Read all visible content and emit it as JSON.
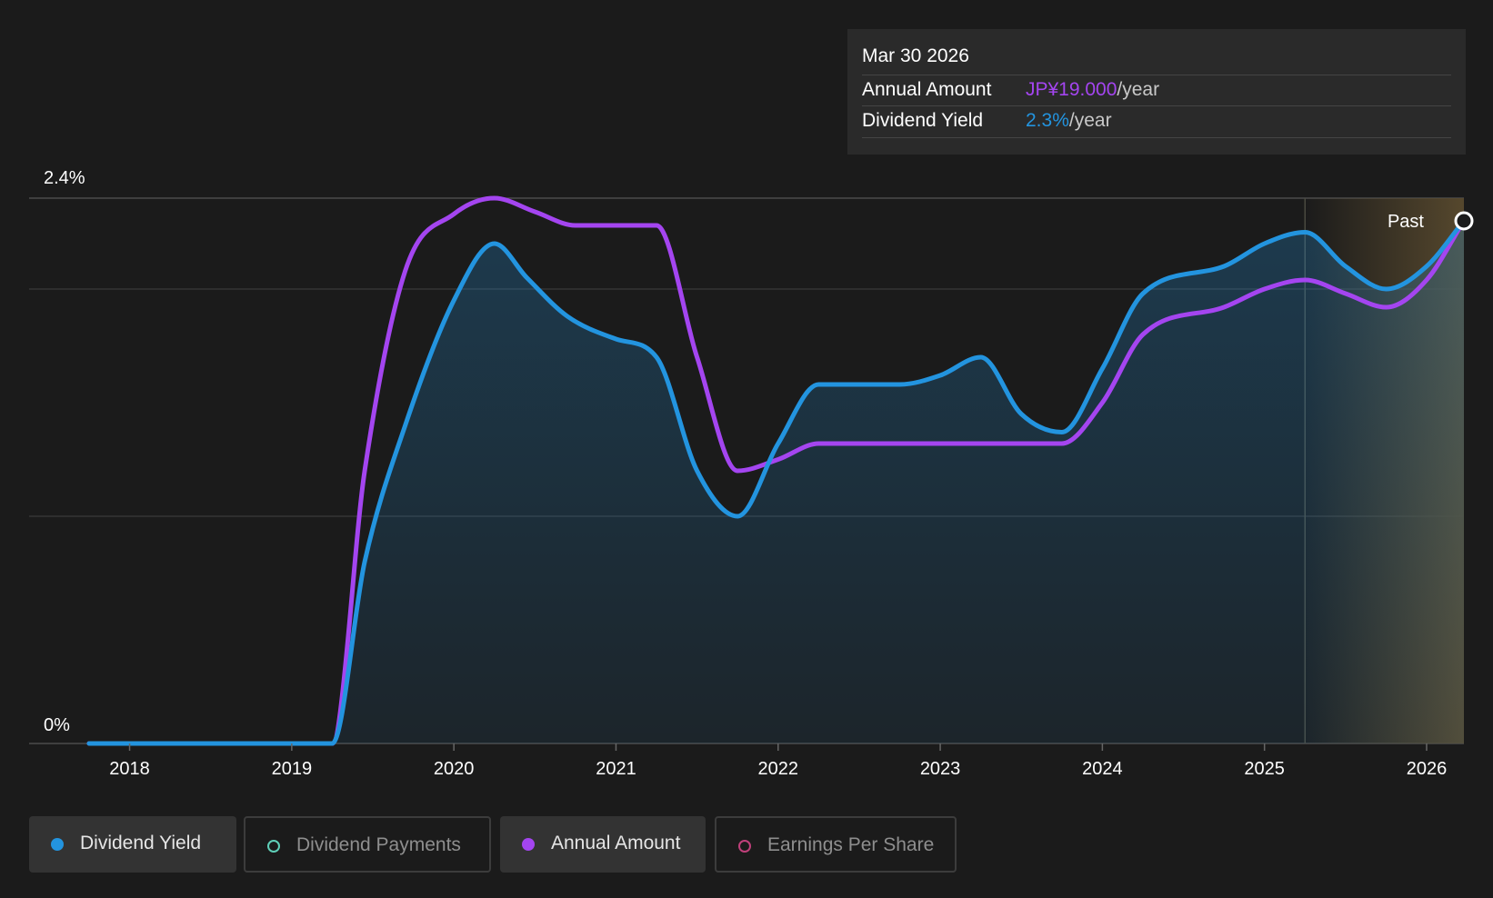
{
  "colors": {
    "background": "#1b1b1b",
    "dividend_yield": "#2394df",
    "annual_amount": "#a445f0",
    "dividend_payments": "#5fcfb8",
    "earnings_per_share": "#c0407a",
    "forecast_tint": "#594a2e"
  },
  "tooltip": {
    "date": "Mar 30 2026",
    "annual_amount_label": "Annual Amount",
    "annual_amount_value": "JP¥19.000",
    "annual_amount_unit": "/year",
    "dividend_yield_label": "Dividend Yield",
    "dividend_yield_value": "2.3%",
    "dividend_yield_unit": "/year"
  },
  "past_label": "Past",
  "legend": [
    {
      "label": "Dividend Yield",
      "active": true,
      "color": "#2394df",
      "icon": "filled-dot-icon"
    },
    {
      "label": "Dividend Payments",
      "active": false,
      "color": "#5fcfb8",
      "icon": "hollow-dot-icon"
    },
    {
      "label": "Annual Amount",
      "active": true,
      "color": "#a445f0",
      "icon": "filled-dot-icon"
    },
    {
      "label": "Earnings Per Share",
      "active": false,
      "color": "#c0407a",
      "icon": "hollow-dot-icon"
    }
  ],
  "chart_data": {
    "type": "area",
    "y_axis": {
      "min": 0,
      "max": 2.4,
      "tick_labels": [
        "0%",
        "2.4%"
      ]
    },
    "x_axis": {
      "min": 2017.38,
      "max": 2026.23,
      "ticks": [
        2018,
        2019,
        2020,
        2021,
        2022,
        2023,
        2024,
        2025,
        2026
      ],
      "tick_labels": [
        "2018",
        "2019",
        "2020",
        "2021",
        "2022",
        "2023",
        "2024",
        "2025",
        "2026"
      ]
    },
    "grid": true,
    "forecast_region_start": 2025.25,
    "series": [
      {
        "name": "Dividend Yield",
        "filled": true,
        "points": [
          [
            2017.75,
            0
          ],
          [
            2019.0,
            0
          ],
          [
            2019.25,
            0
          ],
          [
            2019.45,
            0.8
          ],
          [
            2019.7,
            1.4
          ],
          [
            2020.0,
            1.95
          ],
          [
            2020.25,
            2.2
          ],
          [
            2020.45,
            2.05
          ],
          [
            2020.7,
            1.88
          ],
          [
            2021.0,
            1.78
          ],
          [
            2021.25,
            1.7
          ],
          [
            2021.5,
            1.2
          ],
          [
            2021.75,
            1.0
          ],
          [
            2022.0,
            1.32
          ],
          [
            2022.25,
            1.58
          ],
          [
            2022.75,
            1.58
          ],
          [
            2023.0,
            1.62
          ],
          [
            2023.25,
            1.7
          ],
          [
            2023.5,
            1.45
          ],
          [
            2023.75,
            1.37
          ],
          [
            2024.0,
            1.65
          ],
          [
            2024.25,
            1.98
          ],
          [
            2024.75,
            2.1
          ],
          [
            2025.0,
            2.2
          ],
          [
            2025.25,
            2.25
          ],
          [
            2025.5,
            2.1
          ],
          [
            2025.75,
            2.0
          ],
          [
            2026.0,
            2.1
          ],
          [
            2026.23,
            2.3
          ]
        ]
      },
      {
        "name": "Annual Amount",
        "filled": false,
        "points": [
          [
            2017.75,
            0
          ],
          [
            2019.0,
            0
          ],
          [
            2019.25,
            0
          ],
          [
            2019.45,
            1.2
          ],
          [
            2019.7,
            2.08
          ],
          [
            2020.0,
            2.33
          ],
          [
            2020.25,
            2.4
          ],
          [
            2020.5,
            2.34
          ],
          [
            2020.75,
            2.28
          ],
          [
            2021.25,
            2.28
          ],
          [
            2021.5,
            1.7
          ],
          [
            2021.75,
            1.2
          ],
          [
            2022.0,
            1.25
          ],
          [
            2022.25,
            1.32
          ],
          [
            2023.75,
            1.32
          ],
          [
            2024.0,
            1.5
          ],
          [
            2024.25,
            1.8
          ],
          [
            2024.75,
            1.92
          ],
          [
            2025.0,
            2.0
          ],
          [
            2025.25,
            2.04
          ],
          [
            2025.5,
            1.98
          ],
          [
            2025.75,
            1.92
          ],
          [
            2026.0,
            2.04
          ],
          [
            2026.23,
            2.3
          ]
        ]
      }
    ]
  }
}
